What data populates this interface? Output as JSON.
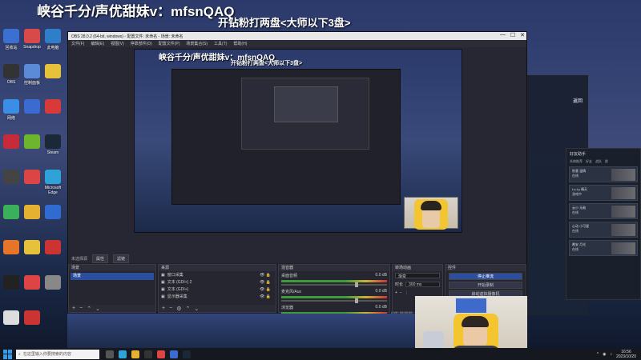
{
  "overlay": {
    "title": "峡谷千分/声优甜妹v：mfsnQAQ",
    "subtitle": "开钻粉打两盘<大师以下3盘>"
  },
  "desktop_icons": [
    {
      "name": "recycle-bin",
      "label": "回收站",
      "color": "#3b6fd0"
    },
    {
      "name": "app2",
      "label": "Snapdrop",
      "color": "#d84a4a"
    },
    {
      "name": "this-pc",
      "label": "此电脑",
      "color": "#2f7ec9"
    },
    {
      "name": "obs",
      "label": "OBS",
      "color": "#333"
    },
    {
      "name": "control",
      "label": "控制面板",
      "color": "#5b8bd6"
    },
    {
      "name": "app-yellow",
      "label": "",
      "color": "#e6c23a"
    },
    {
      "name": "network",
      "label": "网络",
      "color": "#3a8ee6"
    },
    {
      "name": "app-blue",
      "label": "",
      "color": "#3a6bd0"
    },
    {
      "name": "app-red",
      "label": "",
      "color": "#d83a3a"
    },
    {
      "name": "app-red2",
      "label": "",
      "color": "#c62b3a"
    },
    {
      "name": "nvidia",
      "label": "",
      "color": "#6cb52d"
    },
    {
      "name": "steam",
      "label": "Steam",
      "color": "#1b2838"
    },
    {
      "name": "app-g",
      "label": "",
      "color": "#444"
    },
    {
      "name": "app-round",
      "label": "",
      "color": "#d44"
    },
    {
      "name": "edge",
      "label": "Microsoft Edge",
      "color": "#2fa3d8"
    },
    {
      "name": "app-green",
      "label": "",
      "color": "#3ab05a"
    },
    {
      "name": "app-yellow2",
      "label": "",
      "color": "#e6b030"
    },
    {
      "name": "app-blue2",
      "label": "",
      "color": "#2f6bd0"
    },
    {
      "name": "app-orange",
      "label": "",
      "color": "#e6752a"
    },
    {
      "name": "app-star",
      "label": "",
      "color": "#e6c23a"
    },
    {
      "name": "app-red3",
      "label": "",
      "color": "#c33"
    },
    {
      "name": "app-dark",
      "label": "",
      "color": "#222"
    },
    {
      "name": "app-red4",
      "label": "",
      "color": "#d44"
    },
    {
      "name": "app-grey",
      "label": "",
      "color": "#888"
    },
    {
      "name": "app-white",
      "label": "",
      "color": "#ddd"
    },
    {
      "name": "app-red5",
      "label": "",
      "color": "#c33"
    }
  ],
  "obs": {
    "titlebar": "OBS 28.0.2 (64-bit, windows) - 配置文件: 未命名 - 场景: 未命名",
    "window_buttons": [
      "—",
      "☐",
      "✕"
    ],
    "menu": [
      "文件(F)",
      "编辑(E)",
      "视图(V)",
      "停靠部件(D)",
      "配置文件(P)",
      "场景集合(S)",
      "工具(T)",
      "帮助(H)"
    ],
    "nested_title": "峡谷千分/声优甜妹v：mfsnQAQ",
    "nested_sub": "开钻粉打两盘<大师以下3盘>",
    "header_row": {
      "label": "未选择源",
      "btn1": "属性",
      "btn2": "滤镜"
    },
    "docks": {
      "scenes": {
        "title": "场景",
        "items": [
          "场景"
        ]
      },
      "sources": {
        "title": "来源",
        "items": [
          {
            "label": "窗口采集",
            "icon": "window-icon"
          },
          {
            "label": "文本 (GDI+) 2",
            "icon": "text-icon"
          },
          {
            "label": "文本 (GDI+)",
            "icon": "text-icon"
          },
          {
            "label": "显示器采集",
            "icon": "monitor-icon"
          }
        ]
      },
      "mixer": {
        "title": "混音器",
        "channels": [
          {
            "name": "桌面音频",
            "db": "0.0 dB"
          },
          {
            "name": "麦克风/Aux",
            "db": "0.0 dB"
          },
          {
            "name": "浏览器",
            "db": "0.0 dB"
          }
        ]
      },
      "transitions": {
        "title": "转场动画",
        "type": "渐变",
        "duration_label": "时长",
        "duration": "300 ms"
      },
      "controls": {
        "title": "控件",
        "buttons": [
          "停止推流",
          "开始录制",
          "启动虚拟摄像机",
          "工作室模式",
          "设置",
          "退出"
        ]
      }
    },
    "status": "LIVE: 00:00:00"
  },
  "friend_panel": {
    "title": "好友助手",
    "tabs": [
      "系统推荐",
      "好友",
      "战队",
      "群"
    ],
    "items": [
      {
        "name": "秋意 温情",
        "detail": "在线"
      },
      {
        "name": "Lo-Ly 晴天",
        "detail": "游戏中"
      },
      {
        "name": "云小 无敌",
        "detail": "在线"
      },
      {
        "name": "心动 小可爱",
        "detail": "在线"
      },
      {
        "name": "晚安 月光",
        "detail": "在线"
      }
    ]
  },
  "right_back_label": "返回",
  "taskbar": {
    "search_placeholder": "在这里输入你要搜索的内容",
    "time": "16:56",
    "date": "2023/10/20"
  }
}
